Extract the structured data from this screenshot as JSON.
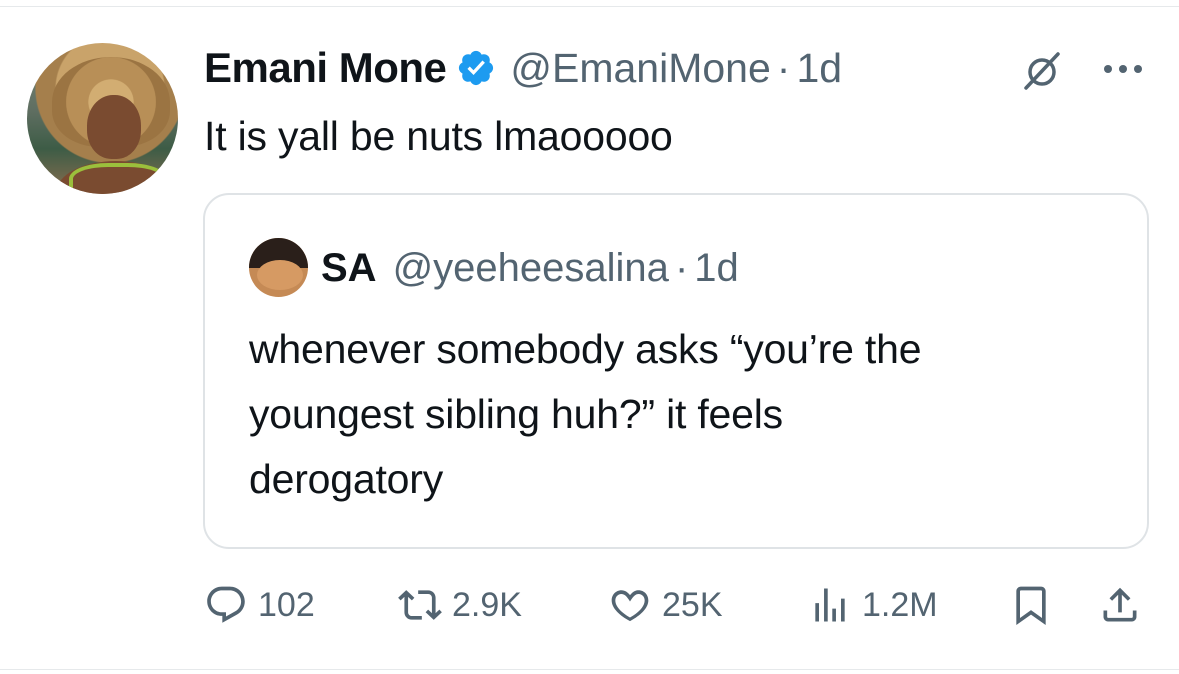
{
  "tweet": {
    "author_name": "Emani Mone",
    "author_handle": "@EmaniMone",
    "separator": "·",
    "time": "1d",
    "text": "It is yall be nuts lmaooooo"
  },
  "quoted_tweet": {
    "author_name": "SA",
    "author_handle": "@yeeheesalina",
    "separator": "·",
    "time": "1d",
    "text_lines": [
      "whenever somebody asks “you’re the",
      "youngest sibling huh?” it feels",
      "derogatory"
    ]
  },
  "actions": {
    "replies": "102",
    "retweets": "2.9K",
    "likes": "25K",
    "views": "1.2M"
  },
  "icons": {
    "verified": "verified-badge-icon",
    "grok": "grok-icon",
    "more": "more-icon",
    "reply": "reply-icon",
    "retweet": "retweet-icon",
    "like": "heart-icon",
    "views": "views-icon",
    "bookmark": "bookmark-icon",
    "share": "share-icon"
  },
  "colors": {
    "text": "#0f1419",
    "secondary": "#536471",
    "verified": "#1d9bf0",
    "border": "#dfe3e6"
  }
}
